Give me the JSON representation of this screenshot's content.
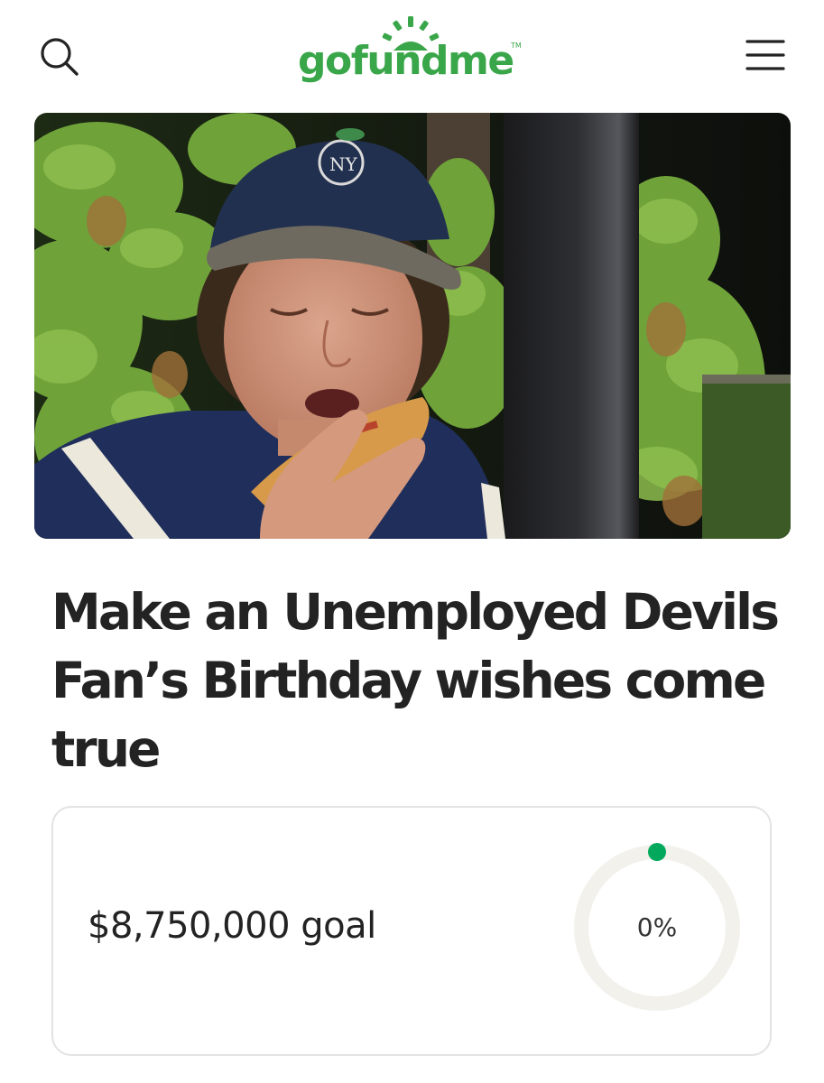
{
  "header": {
    "logo_text": "gofundme",
    "logo_tm": "TM",
    "search_icon": "search-icon",
    "menu_icon": "hamburger-menu-icon"
  },
  "hero": {
    "description": ""
  },
  "campaign": {
    "title": "Make an Unemployed Devils Fan’s Birthday wishes come true"
  },
  "goal_card": {
    "goal_text": "$8,750,000 goal",
    "progress_label": "0%",
    "progress_value": 0
  },
  "colors": {
    "brand_green": "#3aa64a",
    "progress_dot": "#02a95c",
    "ring_track": "#f2f1ec",
    "text": "#232323"
  }
}
